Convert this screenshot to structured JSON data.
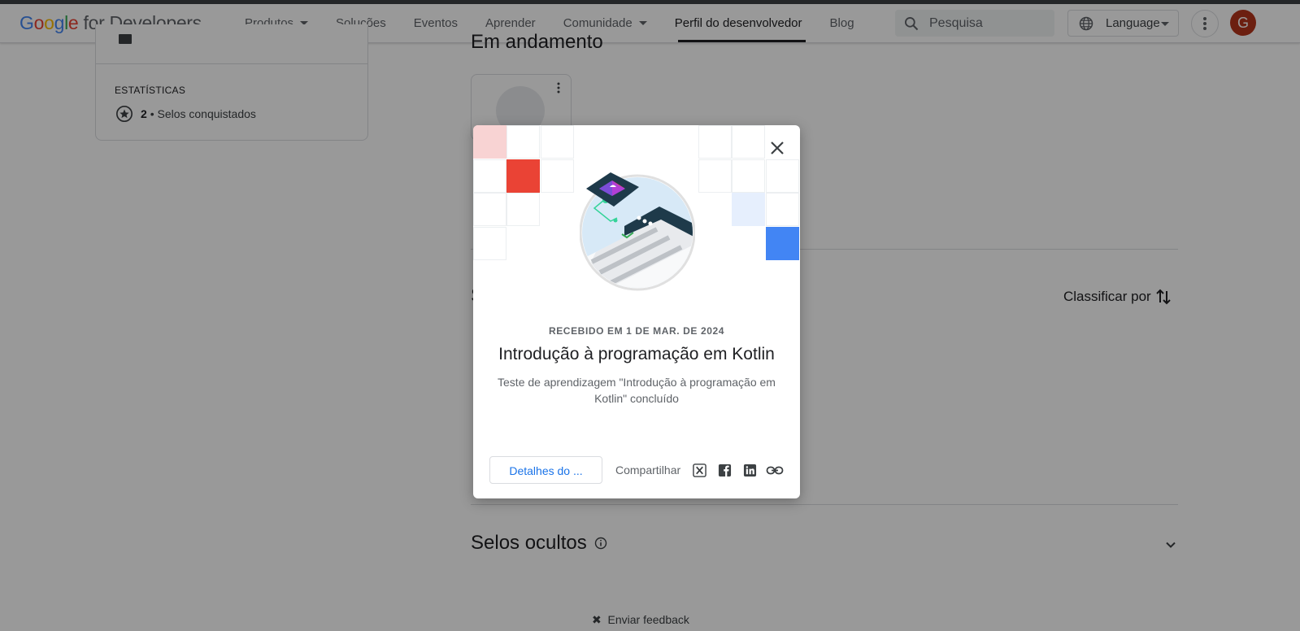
{
  "header": {
    "logo": {
      "brand": "Google",
      "suffix": "for Developers"
    },
    "nav": [
      {
        "label": "Produtos",
        "dropdown": true
      },
      {
        "label": "Soluções"
      },
      {
        "label": "Eventos"
      },
      {
        "label": "Aprender"
      },
      {
        "label": "Comunidade",
        "dropdown": true
      },
      {
        "label": "Perfil do desenvolvedor",
        "active": true
      },
      {
        "label": "Blog"
      }
    ],
    "search_placeholder": "Pesquisa",
    "language_label": "Language",
    "avatar_initial": "G"
  },
  "sidebar": {
    "stats_label": "ESTATÍSTICAS",
    "stats_count": "2",
    "stats_text": "• Selos conquistados"
  },
  "main": {
    "in_progress_title": "Em andamento",
    "cut_letter": "S",
    "sort_label": "Classificar por",
    "hidden_title": "Selos ocultos",
    "feedback_label": "Enviar feedback"
  },
  "modal": {
    "received": "RECEBIDO EM 1 DE MAR. DE 2024",
    "title": "Introdução à programação em Kotlin",
    "description": "Teste de aprendizagem \"Introdução à programação em Kotlin\" concluído",
    "details_button": "Detalhes do ...",
    "share_label": "Compartilhar",
    "share_icons": [
      "x-icon",
      "facebook-icon",
      "linkedin-icon",
      "link-icon"
    ]
  },
  "colors": {
    "red": "#ea4335",
    "pink": "#f8d3d3",
    "blue": "#4285f4",
    "light_blue": "#e6effd",
    "link_blue": "#1a73e8"
  }
}
